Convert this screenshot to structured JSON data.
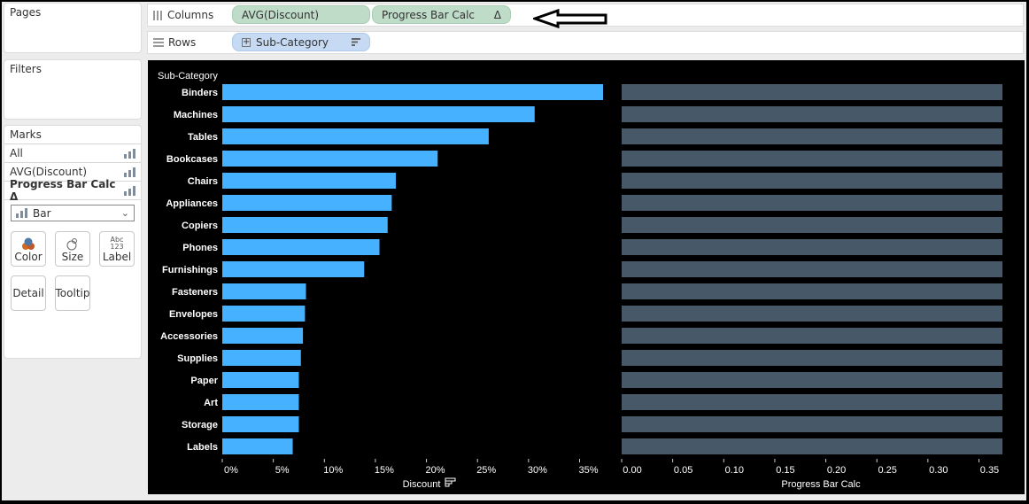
{
  "panes": {
    "pages_title": "Pages",
    "filters_title": "Filters",
    "marks": {
      "title": "Marks",
      "rows": [
        {
          "label": "All",
          "bold": false
        },
        {
          "label": "AVG(Discount)",
          "bold": false
        },
        {
          "label": "Progress Bar Calc Δ",
          "bold": true
        }
      ],
      "mark_type": "Bar",
      "buttons": [
        "Color",
        "Size",
        "Label",
        "Detail",
        "Tooltip"
      ],
      "label_icon_text": "Abc\n123"
    }
  },
  "shelves": {
    "columns_label": "Columns",
    "rows_label": "Rows",
    "columns_pills": [
      "AVG(Discount)",
      "Progress Bar Calc"
    ],
    "delta_symbol": "Δ",
    "rows_pills": [
      "Sub-Category"
    ]
  },
  "colors": {
    "discount_bar": "#45b1ff",
    "progress_bar": "#475868",
    "background": "#000000",
    "text": "#ffffff"
  },
  "chart_data": [
    {
      "type": "bar",
      "orientation": "horizontal",
      "row_header": "Sub-Category",
      "categories": [
        "Binders",
        "Machines",
        "Tables",
        "Bookcases",
        "Chairs",
        "Appliances",
        "Copiers",
        "Phones",
        "Furnishings",
        "Fasteners",
        "Envelopes",
        "Accessories",
        "Supplies",
        "Paper",
        "Art",
        "Storage",
        "Labels"
      ],
      "values": [
        37.3,
        30.6,
        26.1,
        21.1,
        17.0,
        16.6,
        16.2,
        15.4,
        13.9,
        8.2,
        8.1,
        7.9,
        7.7,
        7.5,
        7.5,
        7.5,
        6.9
      ],
      "xlabel": "Discount",
      "x_ticks": [
        "0%",
        "5%",
        "10%",
        "15%",
        "20%",
        "25%",
        "30%",
        "35%"
      ],
      "x_tick_values": [
        0,
        5,
        10,
        15,
        20,
        25,
        30,
        35
      ],
      "xlim": [
        0,
        37.3
      ],
      "unit": "%",
      "sorted": "descending"
    },
    {
      "type": "bar",
      "orientation": "horizontal",
      "categories": [
        "Binders",
        "Machines",
        "Tables",
        "Bookcases",
        "Chairs",
        "Appliances",
        "Copiers",
        "Phones",
        "Furnishings",
        "Fasteners",
        "Envelopes",
        "Accessories",
        "Supplies",
        "Paper",
        "Art",
        "Storage",
        "Labels"
      ],
      "values": [
        0.373,
        0.373,
        0.373,
        0.373,
        0.373,
        0.373,
        0.373,
        0.373,
        0.373,
        0.373,
        0.373,
        0.373,
        0.373,
        0.373,
        0.373,
        0.373,
        0.373
      ],
      "xlabel": "Progress Bar Calc",
      "x_ticks": [
        "0.00",
        "0.05",
        "0.10",
        "0.15",
        "0.20",
        "0.25",
        "0.30",
        "0.35"
      ],
      "x_tick_values": [
        0,
        0.05,
        0.1,
        0.15,
        0.2,
        0.25,
        0.3,
        0.35
      ],
      "xlim": [
        0,
        0.373
      ]
    }
  ]
}
